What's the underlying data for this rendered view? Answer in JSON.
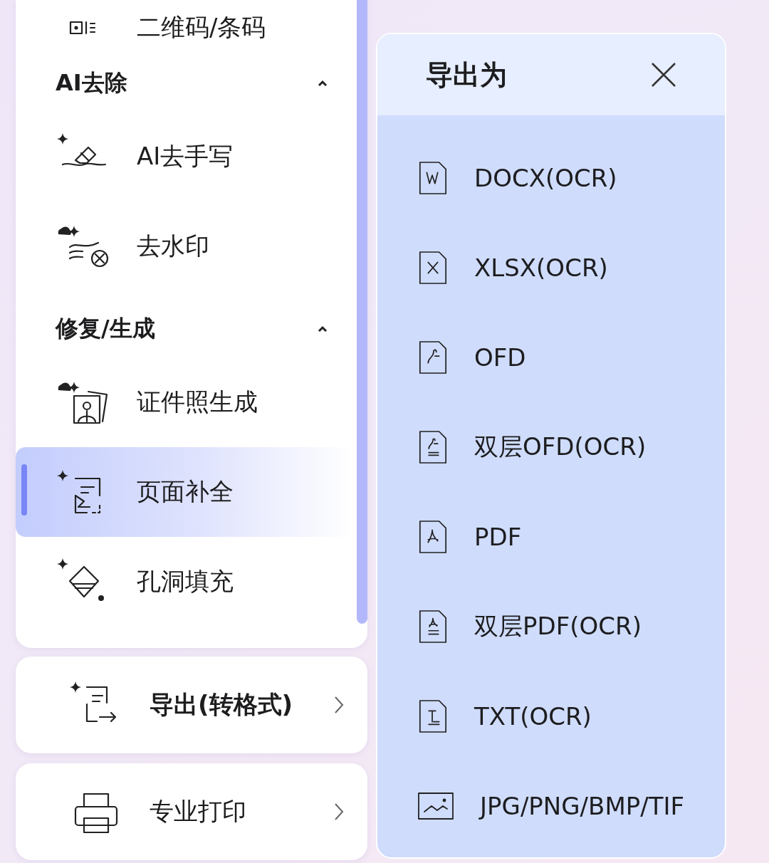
{
  "menu": {
    "items": [
      {
        "kind": "item",
        "label": "二维码/条码",
        "selected": false
      },
      {
        "kind": "header",
        "label": "AI去除",
        "expanded": true
      },
      {
        "kind": "item",
        "label": "AI去手写",
        "selected": false
      },
      {
        "kind": "item",
        "label": "去水印",
        "selected": false
      },
      {
        "kind": "header",
        "label": "修复/生成",
        "expanded": true
      },
      {
        "kind": "item",
        "label": "证件照生成",
        "selected": false
      },
      {
        "kind": "item",
        "label": "页面补全",
        "selected": true
      },
      {
        "kind": "item",
        "label": "孔洞填充",
        "selected": false
      }
    ]
  },
  "actions": [
    {
      "label": "导出(转格式)",
      "selected": true
    },
    {
      "label": "专业打印",
      "selected": false
    }
  ],
  "export_panel": {
    "title": "导出为",
    "formats": [
      {
        "label": "DOCX(OCR)"
      },
      {
        "label": "XLSX(OCR)"
      },
      {
        "label": "OFD"
      },
      {
        "label": "双层OFD(OCR)"
      },
      {
        "label": "PDF"
      },
      {
        "label": "双层PDF(OCR)"
      },
      {
        "label": "TXT(OCR)"
      },
      {
        "label": "JPG/PNG/BMP/TIF"
      }
    ]
  }
}
